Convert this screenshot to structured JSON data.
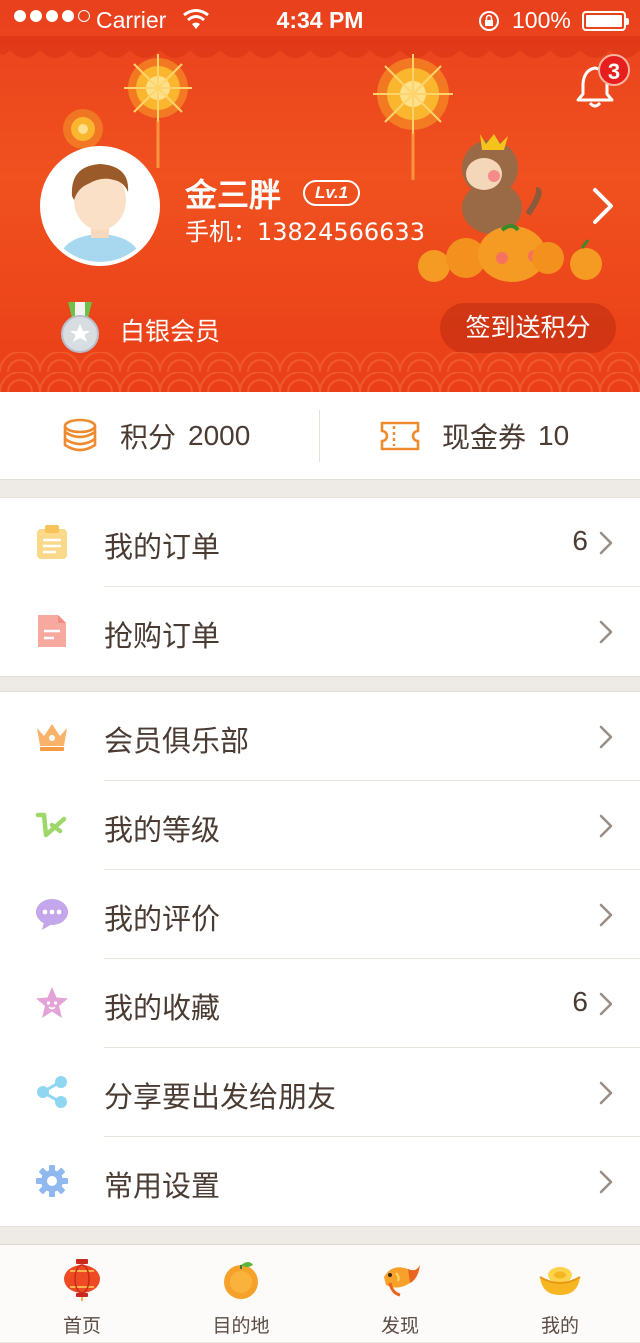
{
  "status_bar": {
    "carrier": "Carrier",
    "time": "4:34 PM",
    "battery": "100%"
  },
  "header": {
    "notification_count": "3",
    "user_name": "金三胖",
    "level_badge": "Lv.1",
    "phone": "手机：13824566633",
    "member_level": "白银会员",
    "checkin_button": "签到送积分"
  },
  "stats": {
    "points": {
      "label": "积分",
      "value": "2000"
    },
    "coupons": {
      "label": "现金券",
      "value": "10"
    }
  },
  "orders": [
    {
      "label": "我的订单",
      "count": "6",
      "icon": "clipboard-icon"
    },
    {
      "label": "抢购订单",
      "count": "",
      "icon": "document-icon"
    }
  ],
  "menu": [
    {
      "label": "会员俱乐部",
      "count": "",
      "icon": "crown-icon"
    },
    {
      "label": "我的等级",
      "count": "",
      "icon": "level-icon"
    },
    {
      "label": "我的评价",
      "count": "",
      "icon": "chat-bubble-icon"
    },
    {
      "label": "我的收藏",
      "count": "6",
      "icon": "star-icon"
    },
    {
      "label": "分享要出发给朋友",
      "count": "",
      "icon": "share-icon"
    },
    {
      "label": "常用设置",
      "count": "",
      "icon": "gear-icon"
    }
  ],
  "tabs": [
    {
      "label": "首页",
      "icon": "lantern-icon"
    },
    {
      "label": "目的地",
      "icon": "orange-icon"
    },
    {
      "label": "发现",
      "icon": "koi-fish-icon"
    },
    {
      "label": "我的",
      "icon": "gold-ingot-icon"
    }
  ],
  "colors": {
    "header_red": "#ea4a1e",
    "accent_orange": "#f08a2e",
    "text_dark": "#4a3b33",
    "background": "#eeebe6"
  }
}
